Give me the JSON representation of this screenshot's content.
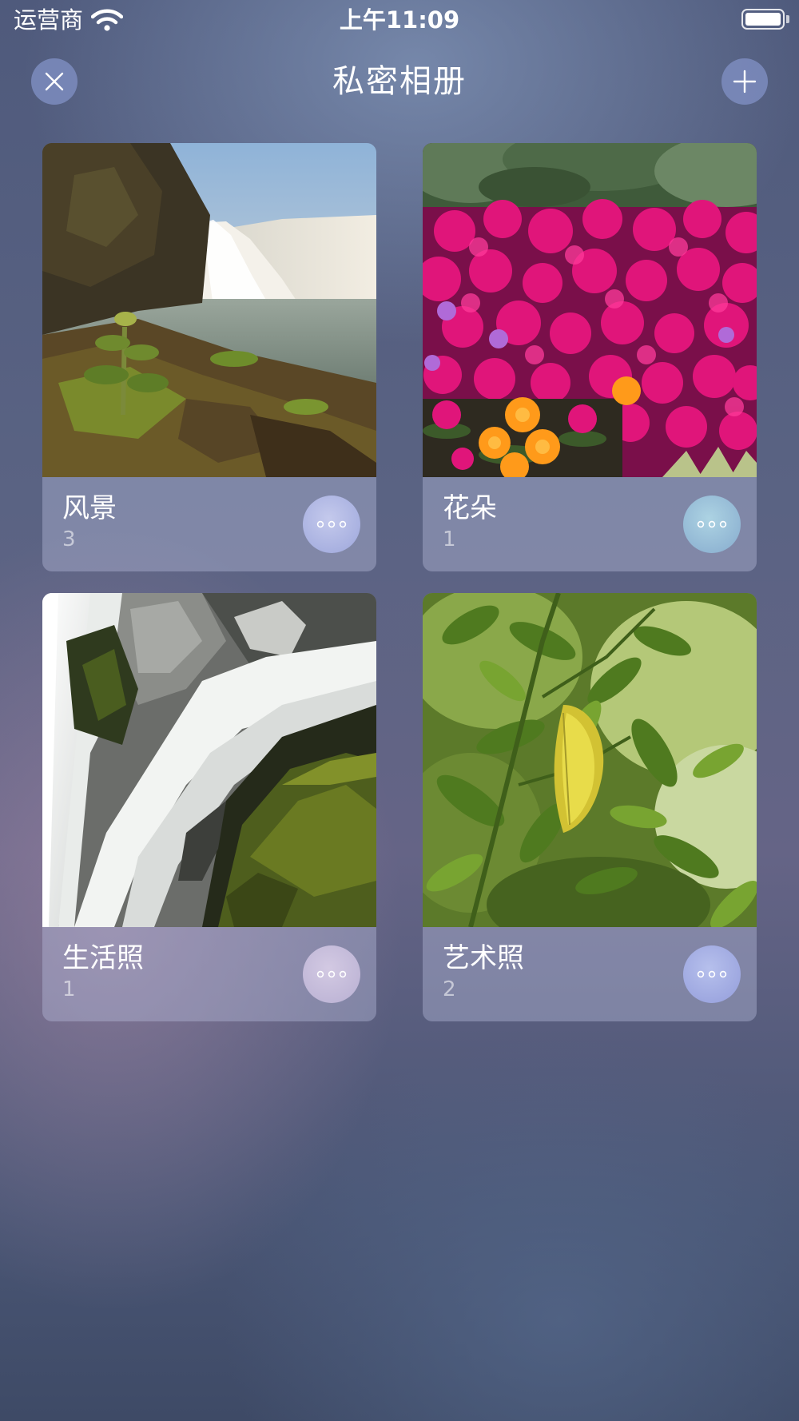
{
  "status_bar": {
    "carrier": "运营商",
    "time": "上午11:09",
    "wifi_icon": "wifi-icon",
    "battery_icon": "battery-icon"
  },
  "nav": {
    "title": "私密相册",
    "close_icon": "close-icon",
    "add_icon": "plus-icon"
  },
  "albums": [
    {
      "name": "风景",
      "count": "3",
      "cover": "waterfall-landscape-photo"
    },
    {
      "name": "花朵",
      "count": "1",
      "cover": "pink-flowers-photo"
    },
    {
      "name": "生活照",
      "count": "1",
      "cover": "waterfall-rocks-photo"
    },
    {
      "name": "艺术照",
      "count": "2",
      "cover": "green-leaves-photo"
    }
  ],
  "colors": {
    "button_fill": "#7d8cbe",
    "card_fill": "#bec3e1",
    "text": "#ffffff"
  }
}
